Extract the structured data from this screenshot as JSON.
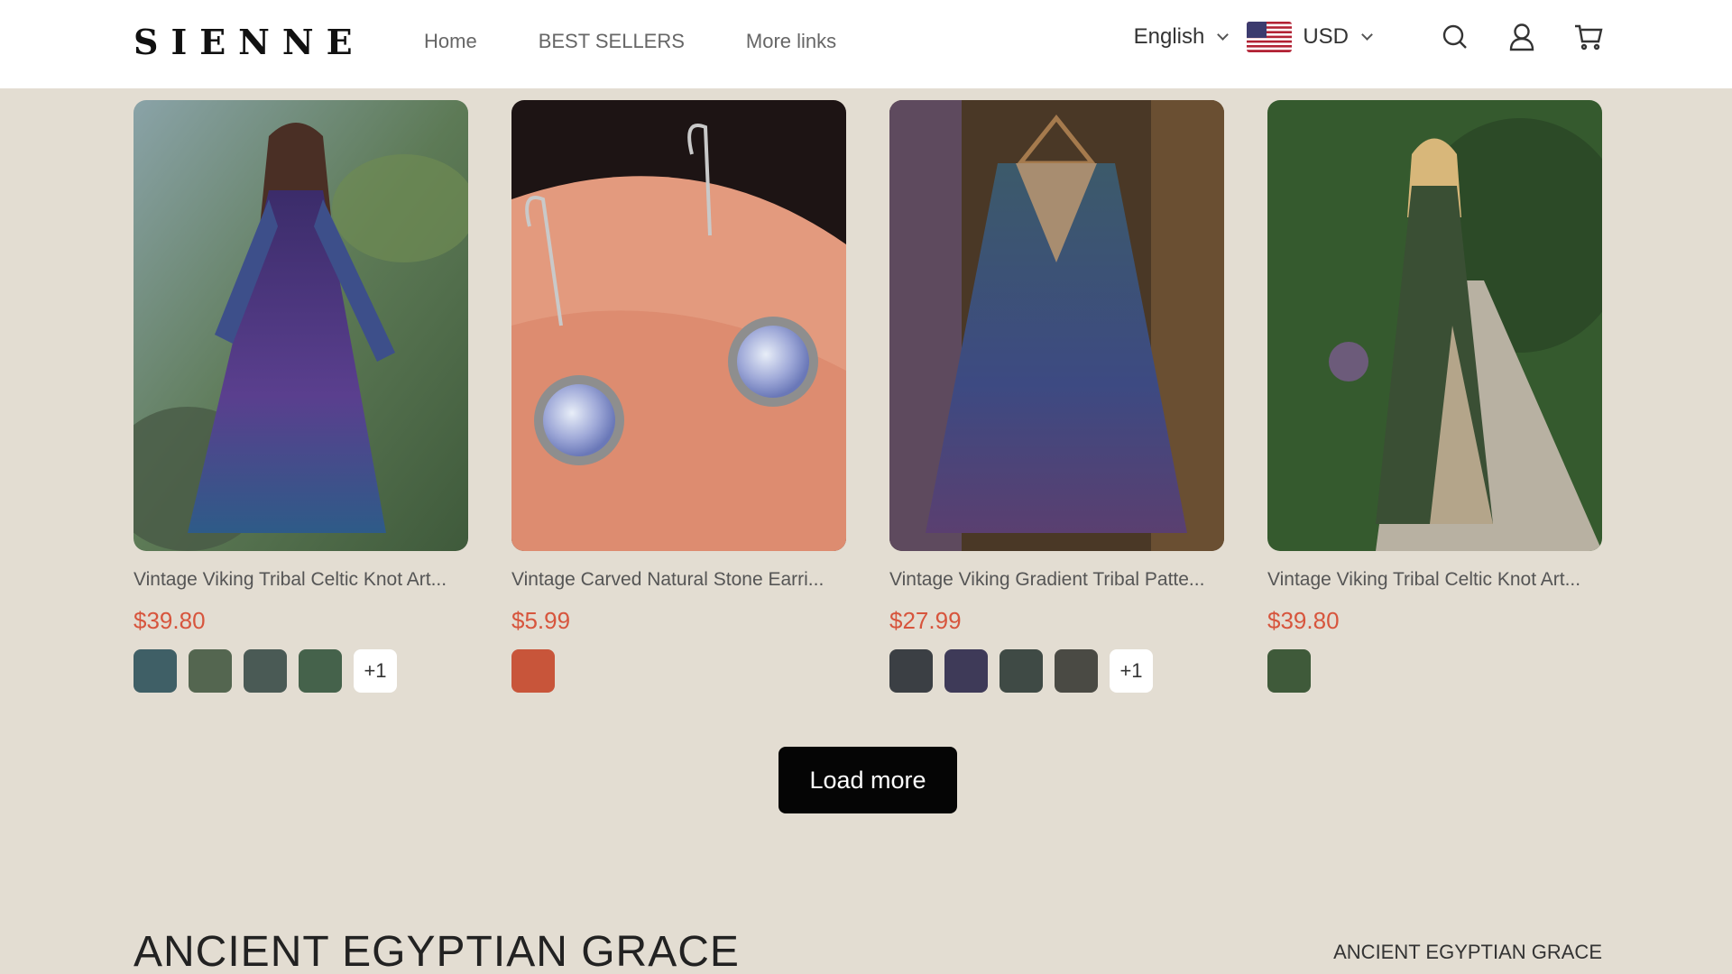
{
  "brand": {
    "logo": "SIENNE"
  },
  "nav": {
    "items": [
      {
        "label": "Home"
      },
      {
        "label": "BEST SELLERS"
      },
      {
        "label": "More links"
      }
    ]
  },
  "header": {
    "language": "English",
    "currency": "USD",
    "icons": [
      "us-flag-icon",
      "search-icon",
      "user-icon",
      "cart-icon"
    ]
  },
  "products": [
    {
      "title": "Vintage Viking Tribal Celtic Knot Art...",
      "price": "$39.80",
      "swatches": [
        "#3f5f66",
        "#546650",
        "#4a5a55",
        "#45624b"
      ],
      "more": "+1"
    },
    {
      "title": "Vintage Carved Natural Stone Earri...",
      "price": "$5.99",
      "swatches": [
        "#c8553a"
      ],
      "more": ""
    },
    {
      "title": "Vintage Viking Gradient Tribal Patte...",
      "price": "$27.99",
      "swatches": [
        "#3b3f44",
        "#3e3a58",
        "#3f4a45",
        "#4a4a44"
      ],
      "more": "+1"
    },
    {
      "title": "Vintage Viking Tribal Celtic Knot Art...",
      "price": "$39.80",
      "swatches": [
        "#3f5a3a"
      ],
      "more": ""
    }
  ],
  "load_more": {
    "label": "Load more"
  },
  "section": {
    "title": "ANCIENT EGYPTIAN GRACE",
    "link": "ANCIENT EGYPTIAN GRACE"
  },
  "colors": {
    "background": "#e3ddd2",
    "price": "#d7553d",
    "button": "#050505"
  }
}
